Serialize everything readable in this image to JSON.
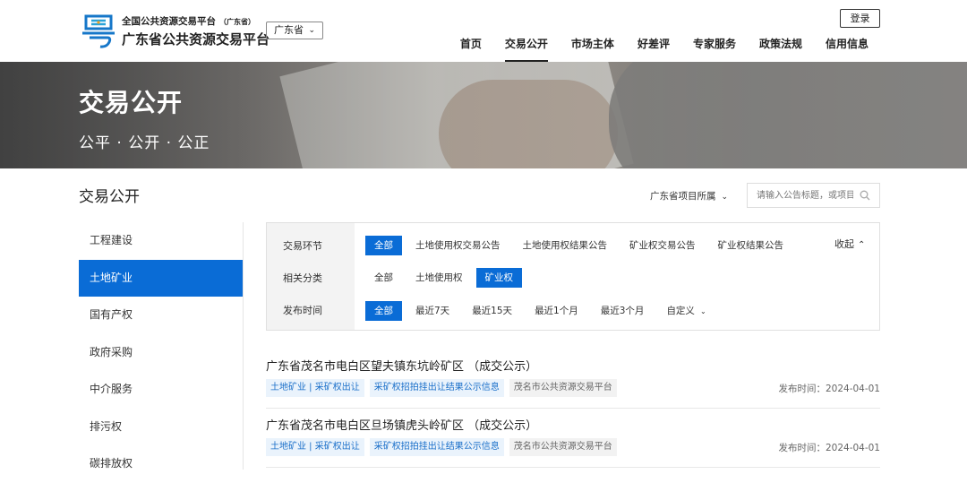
{
  "header": {
    "brand_top": "全国公共资源交易平台",
    "brand_top_small": "（广东省）",
    "brand_main": "广东省公共资源交易平台",
    "region": "广东省",
    "login": "登录",
    "nav": [
      "首页",
      "交易公开",
      "市场主体",
      "好差评",
      "专家服务",
      "政策法规",
      "信用信息"
    ],
    "nav_active": "交易公开"
  },
  "banner": {
    "title": "交易公开",
    "subtitle": "公平 · 公开 · 公正"
  },
  "section": {
    "title": "交易公开",
    "scope": "广东省项目所属",
    "search_placeholder": "请输入公告标题，或项目"
  },
  "sidebar": {
    "items": [
      "工程建设",
      "土地矿业",
      "国有产权",
      "政府采购",
      "中介服务",
      "排污权",
      "碳排放权"
    ],
    "active": "土地矿业"
  },
  "filter": {
    "labels": [
      "交易环节",
      "相关分类",
      "发布时间"
    ],
    "stage": [
      "全部",
      "土地使用权交易公告",
      "土地使用权结果公告",
      "矿业权交易公告",
      "矿业权结果公告"
    ],
    "category": [
      "全部",
      "土地使用权",
      "矿业权"
    ],
    "time": [
      "全部",
      "最近7天",
      "最近15天",
      "最近1个月",
      "最近3个月",
      "自定义"
    ],
    "collapse": "收起"
  },
  "results": [
    {
      "title": "广东省茂名市电白区望夫镇东坑岭矿区 （成交公示）",
      "tag1": "土地矿业 | 采矿权出让",
      "tag2": "采矿权招拍挂出让结果公示信息",
      "tag3": "茂名市公共资源交易平台",
      "date": "发布时间：2024-04-01"
    },
    {
      "title": "广东省茂名市电白区旦场镇虎头岭矿区 （成交公示）",
      "tag1": "土地矿业 | 采矿权出让",
      "tag2": "采矿权招拍挂出让结果公示信息",
      "tag3": "茂名市公共资源交易平台",
      "date": "发布时间：2024-04-01"
    }
  ]
}
